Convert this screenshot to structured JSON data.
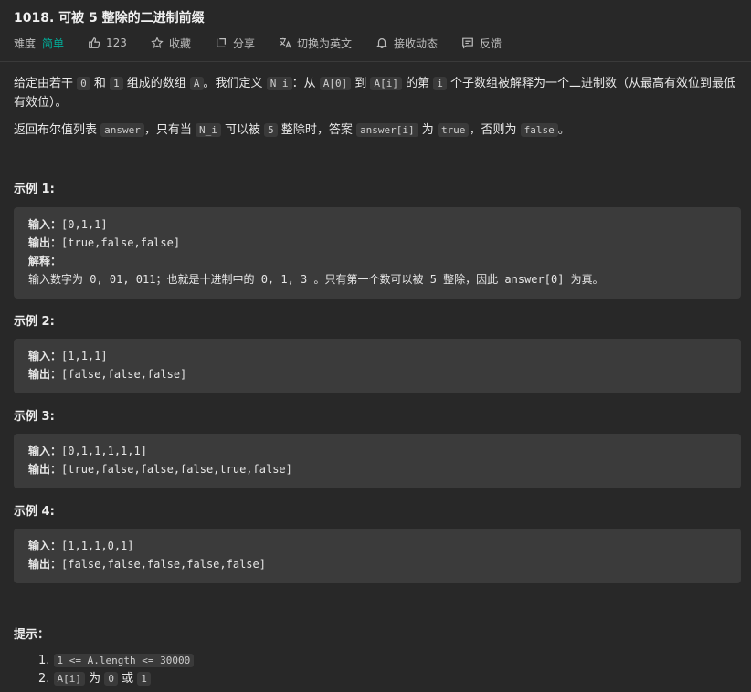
{
  "problem": {
    "title": "1018. 可被 5 整除的二进制前缀",
    "difficulty_label": "难度",
    "difficulty_value": "简单",
    "likes": "123",
    "favorite_label": "收藏",
    "share_label": "分享",
    "translate_label": "切换为英文",
    "notify_label": "接收动态",
    "feedback_label": "反馈"
  },
  "description": {
    "p1": [
      {
        "t": "给定由若干 "
      },
      {
        "c": "0"
      },
      {
        "t": " 和 "
      },
      {
        "c": "1"
      },
      {
        "t": " 组成的数组 "
      },
      {
        "c": "A"
      },
      {
        "t": "。我们定义 "
      },
      {
        "c": "N_i"
      },
      {
        "t": "：从 "
      },
      {
        "c": "A[0]"
      },
      {
        "t": " 到 "
      },
      {
        "c": "A[i]"
      },
      {
        "t": " 的第 "
      },
      {
        "c": "i"
      },
      {
        "t": " 个子数组被解释为一个二进制数（从最高有效位到最低有效位）。"
      }
    ],
    "p2": [
      {
        "t": "返回布尔值列表 "
      },
      {
        "c": "answer"
      },
      {
        "t": "，只有当 "
      },
      {
        "c": "N_i"
      },
      {
        "t": " 可以被 "
      },
      {
        "c": "5"
      },
      {
        "t": " 整除时，答案 "
      },
      {
        "c": "answer[i]"
      },
      {
        "t": " 为 "
      },
      {
        "c": "true"
      },
      {
        "t": "，否则为 "
      },
      {
        "c": "false"
      },
      {
        "t": "。"
      }
    ]
  },
  "examples": [
    {
      "title": "示例 1:",
      "lines": [
        [
          "输入：",
          "[0,1,1]"
        ],
        [
          "输出：",
          "[true,false,false]"
        ],
        [
          "解释：",
          ""
        ],
        [
          "",
          "输入数字为 0, 01, 011；也就是十进制中的 0, 1, 3 。只有第一个数可以被 5 整除，因此 answer[0] 为真。"
        ]
      ]
    },
    {
      "title": "示例 2:",
      "lines": [
        [
          "输入：",
          "[1,1,1]"
        ],
        [
          "输出：",
          "[false,false,false]"
        ]
      ]
    },
    {
      "title": "示例 3:",
      "lines": [
        [
          "输入：",
          "[0,1,1,1,1,1]"
        ],
        [
          "输出：",
          "[true,false,false,false,true,false]"
        ]
      ]
    },
    {
      "title": "示例 4:",
      "lines": [
        [
          "输入：",
          "[1,1,1,0,1]"
        ],
        [
          "输出：",
          "[false,false,false,false,false]"
        ]
      ]
    }
  ],
  "hints": {
    "title": "提示：",
    "items": [
      [
        {
          "c": "1 <= A.length <= 30000"
        }
      ],
      [
        {
          "c": "A[i]"
        },
        {
          "t": " 为 "
        },
        {
          "c": "0"
        },
        {
          "t": " 或 "
        },
        {
          "c": "1"
        }
      ]
    ]
  }
}
